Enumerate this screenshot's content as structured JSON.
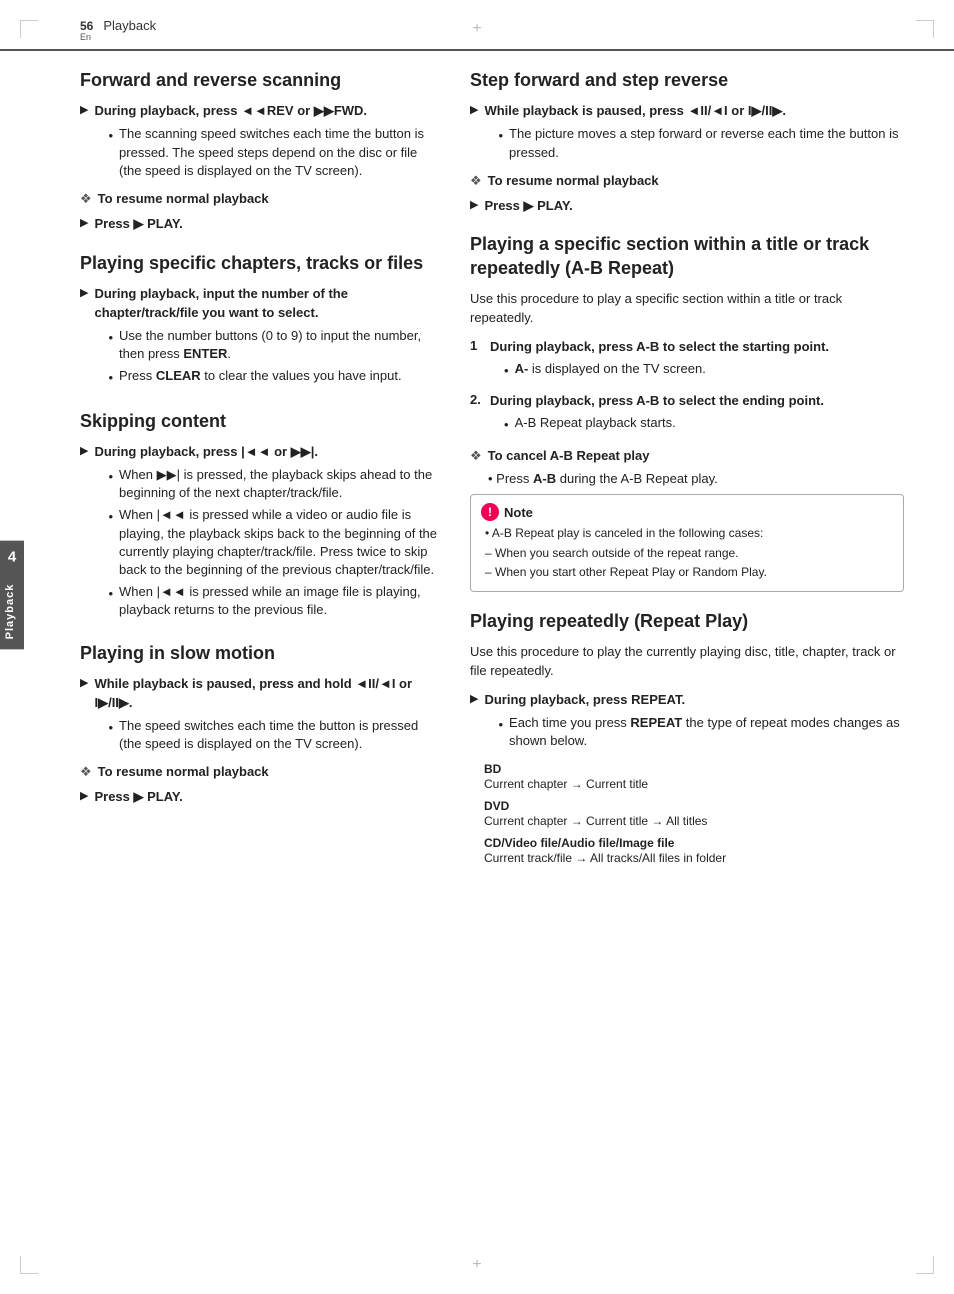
{
  "page": {
    "number": "56",
    "lang": "En",
    "chapter": "Playback"
  },
  "side_tab": {
    "number": "4",
    "label": "Playback"
  },
  "sections": {
    "forward_reverse": {
      "title": "Forward and reverse scanning",
      "step1": {
        "arrow": "▶",
        "text_bold": "During playback, press ◄◄REV or ▶▶FWD.",
        "sub_bullets": [
          "The scanning speed switches each time the button is pressed. The speed steps depend on the disc or file (the speed is displayed on the TV screen)."
        ]
      },
      "step2": {
        "diamond": "❖",
        "text": "To resume normal playback"
      },
      "step3": {
        "arrow": "▶",
        "text": "Press ▶ PLAY."
      }
    },
    "specific_chapters": {
      "title": "Playing specific chapters, tracks or files",
      "step1": {
        "arrow": "▶",
        "text_bold": "During playback, input the number of the chapter/track/file you want to select.",
        "sub_bullets": [
          "Use the number buttons (0 to 9) to input the number, then press ENTER.",
          "Press CLEAR to clear the values you have input."
        ]
      }
    },
    "skipping": {
      "title": "Skipping content",
      "step1": {
        "arrow": "▶",
        "text_bold": "During playback, press |◄◄ or ▶▶|.",
        "sub_bullets": [
          "When ▶▶| is pressed, the playback skips ahead to the beginning of the next chapter/track/file.",
          "When |◄◄ is pressed while a video or audio file is playing, the playback skips back to the beginning of the currently playing chapter/track/file. Press twice to skip back to the beginning of the previous chapter/track/file.",
          "When |◄◄ is pressed while an image file is playing, playback returns to the previous file."
        ]
      }
    },
    "slow_motion": {
      "title": "Playing in slow motion",
      "step1": {
        "arrow": "▶",
        "text_bold": "While playback is paused, press and hold ◄II/◄I or I▶/II▶.",
        "sub_bullets": [
          "The speed switches each time the button is pressed (the speed is displayed on the TV screen)."
        ]
      },
      "step2": {
        "diamond": "❖",
        "text": "To resume normal playback"
      },
      "step3": {
        "arrow": "▶",
        "text": "Press ▶ PLAY."
      }
    },
    "step_forward": {
      "title": "Step forward and step reverse",
      "step1": {
        "arrow": "▶",
        "text_bold": "While playback is paused, press ◄II/◄I or I▶/II▶.",
        "sub_bullets": [
          "The picture moves a step forward or reverse each time the button is pressed."
        ]
      },
      "step2": {
        "diamond": "❖",
        "text": "To resume normal playback"
      },
      "step3": {
        "arrow": "▶",
        "text": "Press ▶ PLAY."
      }
    },
    "ab_repeat": {
      "title": "Playing a specific section within a title or track repeatedly (A-B Repeat)",
      "intro": "Use this procedure to play a specific section within a title or track repeatedly.",
      "numbered": [
        {
          "num": "1",
          "text_bold": "During playback, press A-B to select the starting point.",
          "sub_bullets": [
            "A- is displayed on the TV screen."
          ]
        },
        {
          "num": "2.",
          "text_bold": "During playback, press A-B to select the ending point.",
          "sub_bullets": [
            "A-B Repeat playback starts."
          ]
        }
      ],
      "cancel": {
        "diamond": "❖",
        "text": "To cancel A-B Repeat play",
        "sub_bullet": "Press A-B during the A-B Repeat play."
      },
      "note": {
        "title": "Note",
        "bullets": [
          "A-B Repeat play is canceled in the following cases:",
          "– When you search outside of the repeat range.",
          "– When you start other Repeat Play or Random Play."
        ]
      }
    },
    "repeat_play": {
      "title": "Playing repeatedly (Repeat Play)",
      "intro": "Use this procedure to play the currently playing disc, title, chapter, track or file repeatedly.",
      "step1": {
        "arrow": "▶",
        "text_bold": "During playback, press REPEAT.",
        "sub_bullets": [
          "Each time you press REPEAT the type of repeat modes changes as shown below."
        ]
      },
      "modes": [
        {
          "label": "BD",
          "value": "Current chapter → Current title"
        },
        {
          "label": "DVD",
          "value": "Current chapter → Current title → All titles"
        },
        {
          "label": "CD/Video file/Audio file/Image file",
          "value": "Current track/file → All tracks/All files in folder"
        }
      ]
    }
  }
}
